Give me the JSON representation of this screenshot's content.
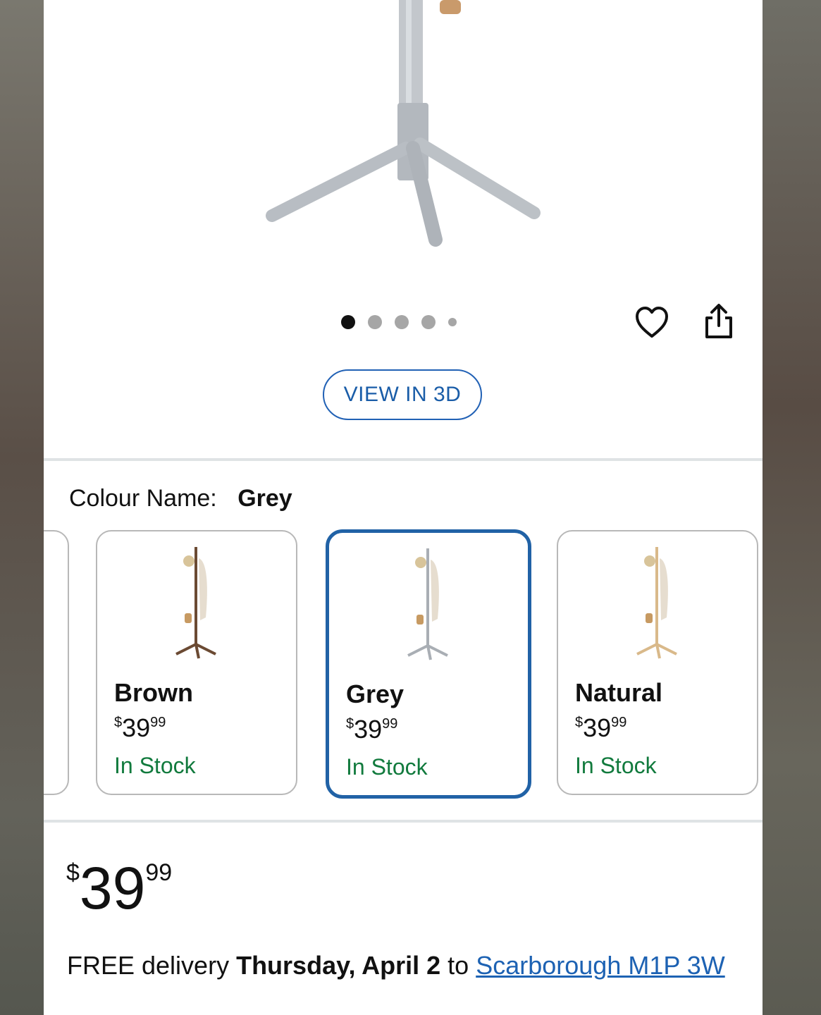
{
  "carousel": {
    "dot_count": 5,
    "active_index": 0
  },
  "actions": {
    "wishlist_icon": "heart-outline-icon",
    "share_icon": "share-icon"
  },
  "view3d": {
    "label": "VIEW IN 3D"
  },
  "colour": {
    "label": "Colour Name:",
    "value": "Grey"
  },
  "swatches": [
    {
      "name": "Brown",
      "currency": "$",
      "whole": "39",
      "cents": "99",
      "stock": "In Stock"
    },
    {
      "name": "Grey",
      "currency": "$",
      "whole": "39",
      "cents": "99",
      "stock": "In Stock"
    },
    {
      "name": "Natural",
      "currency": "$",
      "whole": "39",
      "cents": "99",
      "stock": "In Stock"
    }
  ],
  "price": {
    "currency": "$",
    "whole": "39",
    "cents": "99"
  },
  "delivery": {
    "prefix": "FREE delivery",
    "date": "Thursday, April 2",
    "to": "to",
    "location": "Scarborough M1P 3W"
  },
  "colors": {
    "accent_blue": "#2162a6",
    "in_stock_green": "#117a3d",
    "link_blue": "#1d62b3"
  }
}
